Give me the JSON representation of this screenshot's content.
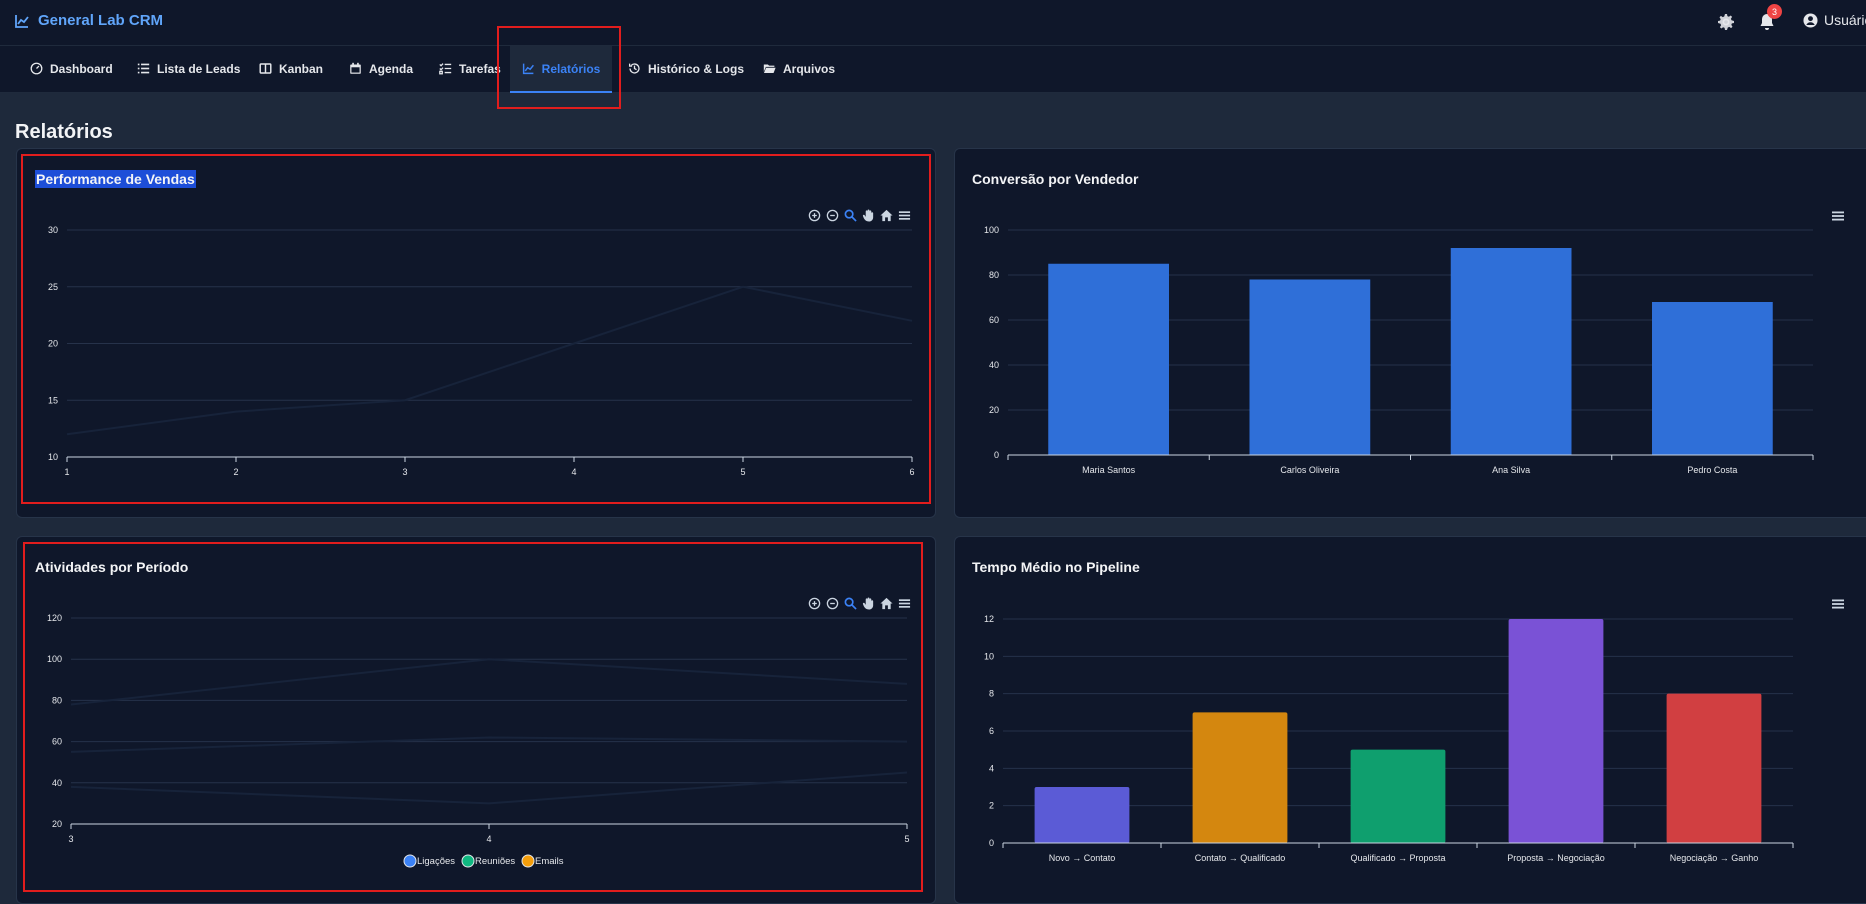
{
  "header": {
    "app_title": "General Lab CRM",
    "notification_count": "3",
    "user_label": "Usuário"
  },
  "nav": {
    "tabs": [
      {
        "label": "Dashboard",
        "icon": "gauge-icon"
      },
      {
        "label": "Lista de Leads",
        "icon": "list-icon"
      },
      {
        "label": "Kanban",
        "icon": "columns-icon"
      },
      {
        "label": "Agenda",
        "icon": "calendar-icon"
      },
      {
        "label": "Tarefas",
        "icon": "checklist-icon"
      },
      {
        "label": "Relatórios",
        "icon": "chart-line-icon",
        "active": true
      },
      {
        "label": "Histórico & Logs",
        "icon": "history-icon"
      },
      {
        "label": "Arquivos",
        "icon": "folder-open-icon"
      }
    ]
  },
  "page": {
    "title": "Relatórios"
  },
  "colors": {
    "accent": "#3b82f6",
    "header_bg": "#0f172a",
    "page_bg": "#1e293b",
    "highlight": "#e11d1d",
    "bar_blue": "#2f6fd8",
    "pipeline": [
      "#5b5bd6",
      "#d4870f",
      "#0f9f6e",
      "#7a52d6",
      "#d13f41"
    ]
  },
  "chart_data": [
    {
      "id": "performance",
      "type": "line",
      "title": "Performance de Vendas",
      "x": [
        1,
        2,
        3,
        4,
        5,
        6
      ],
      "series": [
        {
          "values": [
            12,
            14,
            15,
            20,
            25,
            22
          ]
        }
      ],
      "xlim": [
        1,
        6
      ],
      "ylim": [
        10,
        30
      ],
      "yticks": [
        10,
        15,
        20,
        25,
        30
      ],
      "xticks": [
        "1",
        "2",
        "3",
        "4",
        "5",
        "6"
      ],
      "grid": true
    },
    {
      "id": "conversao",
      "type": "bar",
      "title": "Conversão por Vendedor",
      "categories": [
        "Maria Santos",
        "Carlos Oliveira",
        "Ana Silva",
        "Pedro Costa"
      ],
      "values": [
        85,
        78,
        92,
        68
      ],
      "ylim": [
        0,
        100
      ],
      "yticks": [
        0,
        20,
        40,
        60,
        80,
        100
      ],
      "grid": true
    },
    {
      "id": "atividades",
      "type": "line",
      "title": "Atividades por Período",
      "x": [
        3,
        4,
        5
      ],
      "xlim": [
        3,
        5
      ],
      "ylim": [
        20,
        120
      ],
      "yticks": [
        20,
        40,
        60,
        80,
        100,
        120
      ],
      "xticks": [
        "3",
        "4",
        "5"
      ],
      "legend": "bottom-center",
      "series": [
        {
          "name": "Ligações",
          "color": "#3b82f6",
          "values": [
            78,
            100,
            88
          ]
        },
        {
          "name": "Reuniões",
          "color": "#10b981",
          "values": [
            55,
            62,
            60
          ]
        },
        {
          "name": "Emails",
          "color": "#f59e0b",
          "values": [
            38,
            30,
            45
          ]
        }
      ],
      "grid": true
    },
    {
      "id": "pipeline",
      "type": "bar",
      "title": "Tempo Médio no Pipeline",
      "categories": [
        "Novo → Contato",
        "Contato → Qualificado",
        "Qualificado → Proposta",
        "Proposta → Negociação",
        "Negociação → Ganho"
      ],
      "values": [
        3,
        7,
        5,
        12,
        8
      ],
      "ylim": [
        0,
        12
      ],
      "yticks": [
        0,
        2,
        4,
        6,
        8,
        10,
        12
      ],
      "grid": true
    }
  ]
}
